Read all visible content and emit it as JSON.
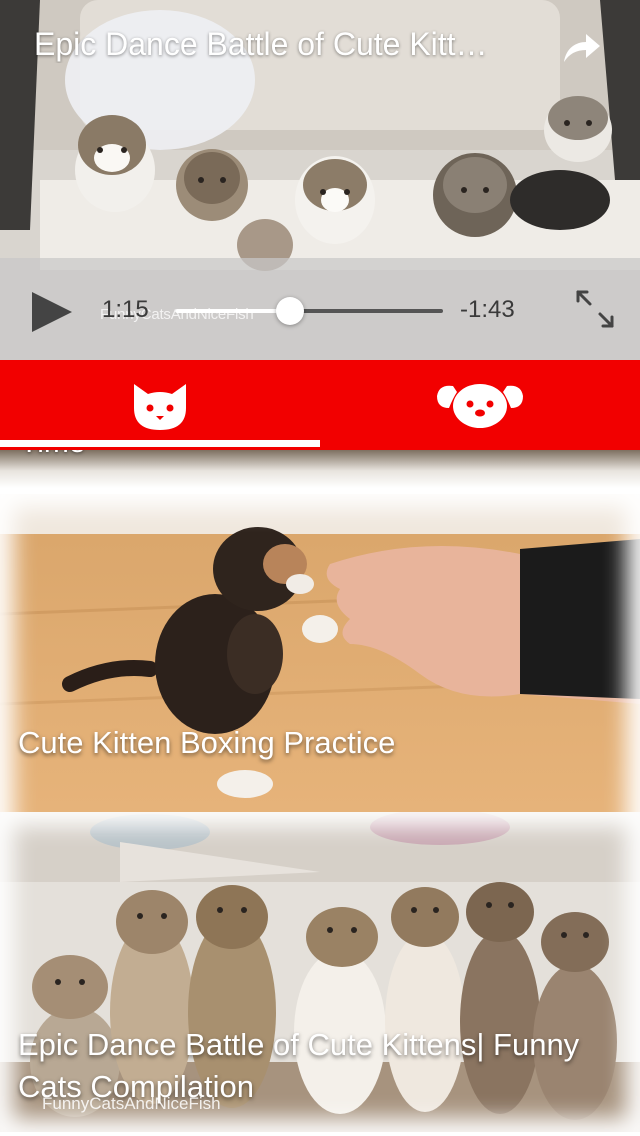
{
  "player": {
    "title": "Epic Dance Battle of Cute Kitt…",
    "time_current": "1:15",
    "time_remaining": "-1:43",
    "progress": 0.43,
    "watermark": "FunnyCatsAndNiceFish",
    "icons": {
      "share": "share-arrow-icon",
      "play": "play-icon",
      "expand": "expand-icon"
    }
  },
  "tabs": [
    {
      "id": "cats",
      "icon": "cat-face-icon",
      "selected": true
    },
    {
      "id": "dogs",
      "icon": "dog-face-icon",
      "selected": false
    }
  ],
  "feed": {
    "peek_title": "Time",
    "videos": [
      {
        "title": "Cute Kitten Boxing Practice"
      },
      {
        "title": "Epic Dance Battle of Cute Kittens| Funny Cats Compilation",
        "watermark": "FunnyCatsAndNiceFish"
      }
    ]
  },
  "colors": {
    "tab_bar": "#f20000",
    "indicator": "#ffffff",
    "controls_bg": "#c8c8c8"
  }
}
